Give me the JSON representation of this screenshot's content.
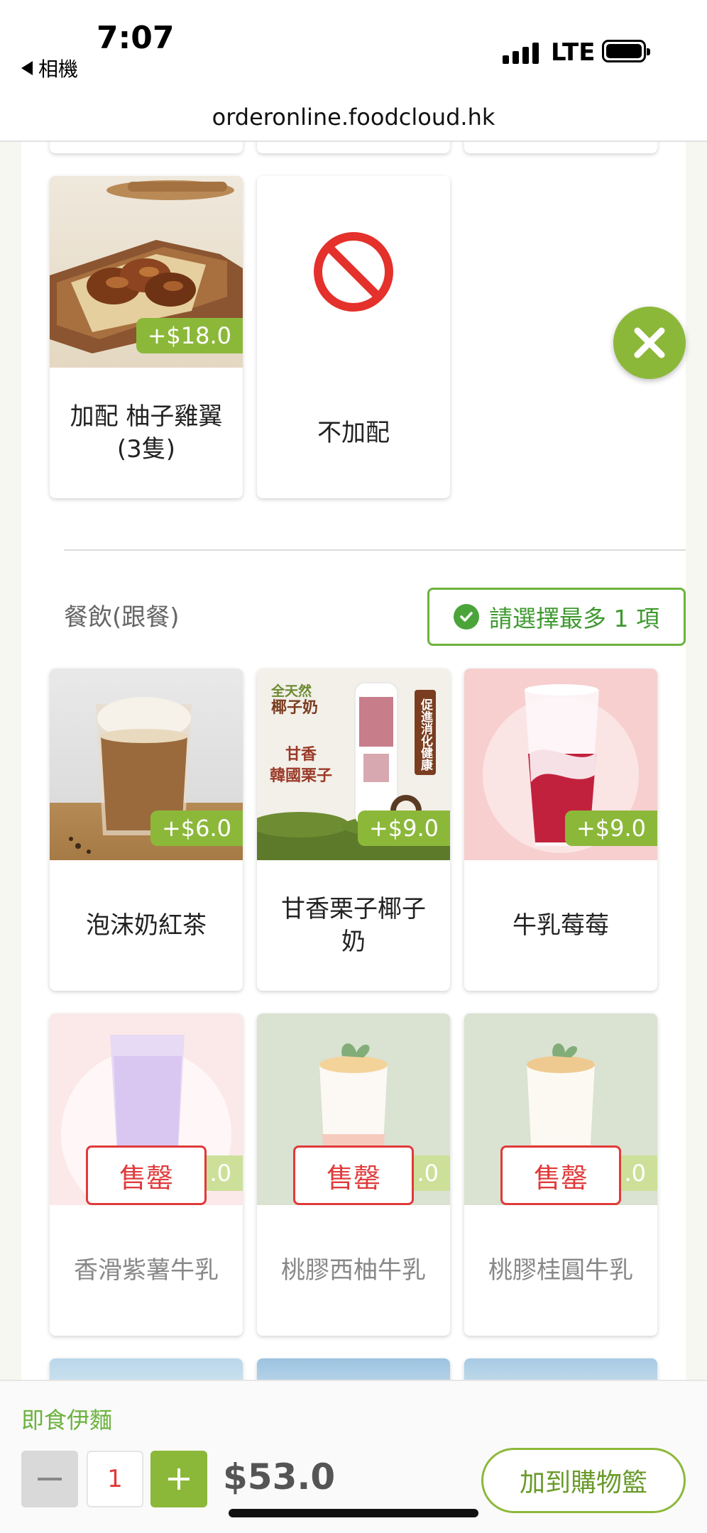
{
  "status_bar": {
    "time": "7:07",
    "back_app": "相機",
    "network": "LTE"
  },
  "browser": {
    "url": "orderonline.foodcloud.hk"
  },
  "addon_options": [
    {
      "name": "加配 柚子雞翼(3隻)",
      "price": "+$18.0",
      "image": "chicken-wings-photo"
    },
    {
      "name": "不加配",
      "image": "no-entry-icon"
    }
  ],
  "drink_section": {
    "title": "餐飲(跟餐)",
    "hint": "請選擇最多 1 項",
    "items": [
      {
        "name": "泡沫奶紅茶",
        "price": "+$6.0",
        "sold_out": false
      },
      {
        "name": "甘香栗子椰子奶",
        "price": "+$9.0",
        "sold_out": false,
        "image_text": [
          "全天然",
          "椰子奶",
          "甘香",
          "韓國栗子",
          "促進消化健康"
        ]
      },
      {
        "name": "牛乳莓莓",
        "price": "+$9.0",
        "sold_out": false
      },
      {
        "name": "香滑紫薯牛乳",
        "price": ".0",
        "sold_out": true
      },
      {
        "name": "桃膠西柚牛乳",
        "price": ".0",
        "sold_out": true
      },
      {
        "name": "桃膠桂圓牛乳",
        "price": ".0",
        "sold_out": true
      }
    ],
    "sold_out_label": "售罄"
  },
  "cart_bar": {
    "item_name": "即食伊麵",
    "quantity": "1",
    "total": "$53.0",
    "add_to_cart": "加到購物籃"
  },
  "colors": {
    "accent": "#8cb83a",
    "sold_out": "#e03a3a",
    "hint": "#3e9a2f"
  }
}
